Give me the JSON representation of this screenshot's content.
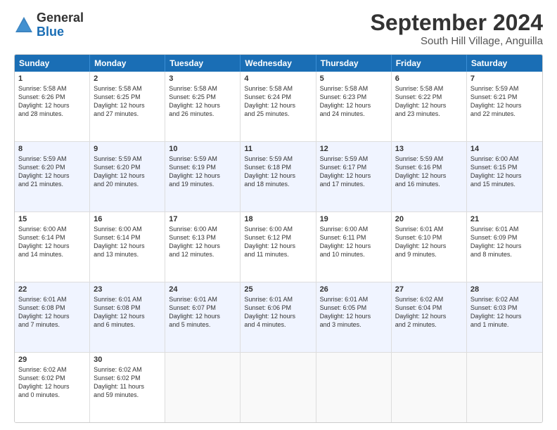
{
  "logo": {
    "general": "General",
    "blue": "Blue"
  },
  "title": "September 2024",
  "subtitle": "South Hill Village, Anguilla",
  "days": [
    "Sunday",
    "Monday",
    "Tuesday",
    "Wednesday",
    "Thursday",
    "Friday",
    "Saturday"
  ],
  "rows": [
    [
      {
        "day": "1",
        "lines": [
          "Sunrise: 5:58 AM",
          "Sunset: 6:26 PM",
          "Daylight: 12 hours",
          "and 28 minutes."
        ]
      },
      {
        "day": "2",
        "lines": [
          "Sunrise: 5:58 AM",
          "Sunset: 6:25 PM",
          "Daylight: 12 hours",
          "and 27 minutes."
        ]
      },
      {
        "day": "3",
        "lines": [
          "Sunrise: 5:58 AM",
          "Sunset: 6:25 PM",
          "Daylight: 12 hours",
          "and 26 minutes."
        ]
      },
      {
        "day": "4",
        "lines": [
          "Sunrise: 5:58 AM",
          "Sunset: 6:24 PM",
          "Daylight: 12 hours",
          "and 25 minutes."
        ]
      },
      {
        "day": "5",
        "lines": [
          "Sunrise: 5:58 AM",
          "Sunset: 6:23 PM",
          "Daylight: 12 hours",
          "and 24 minutes."
        ]
      },
      {
        "day": "6",
        "lines": [
          "Sunrise: 5:58 AM",
          "Sunset: 6:22 PM",
          "Daylight: 12 hours",
          "and 23 minutes."
        ]
      },
      {
        "day": "7",
        "lines": [
          "Sunrise: 5:59 AM",
          "Sunset: 6:21 PM",
          "Daylight: 12 hours",
          "and 22 minutes."
        ]
      }
    ],
    [
      {
        "day": "8",
        "lines": [
          "Sunrise: 5:59 AM",
          "Sunset: 6:20 PM",
          "Daylight: 12 hours",
          "and 21 minutes."
        ]
      },
      {
        "day": "9",
        "lines": [
          "Sunrise: 5:59 AM",
          "Sunset: 6:20 PM",
          "Daylight: 12 hours",
          "and 20 minutes."
        ]
      },
      {
        "day": "10",
        "lines": [
          "Sunrise: 5:59 AM",
          "Sunset: 6:19 PM",
          "Daylight: 12 hours",
          "and 19 minutes."
        ]
      },
      {
        "day": "11",
        "lines": [
          "Sunrise: 5:59 AM",
          "Sunset: 6:18 PM",
          "Daylight: 12 hours",
          "and 18 minutes."
        ]
      },
      {
        "day": "12",
        "lines": [
          "Sunrise: 5:59 AM",
          "Sunset: 6:17 PM",
          "Daylight: 12 hours",
          "and 17 minutes."
        ]
      },
      {
        "day": "13",
        "lines": [
          "Sunrise: 5:59 AM",
          "Sunset: 6:16 PM",
          "Daylight: 12 hours",
          "and 16 minutes."
        ]
      },
      {
        "day": "14",
        "lines": [
          "Sunrise: 6:00 AM",
          "Sunset: 6:15 PM",
          "Daylight: 12 hours",
          "and 15 minutes."
        ]
      }
    ],
    [
      {
        "day": "15",
        "lines": [
          "Sunrise: 6:00 AM",
          "Sunset: 6:14 PM",
          "Daylight: 12 hours",
          "and 14 minutes."
        ]
      },
      {
        "day": "16",
        "lines": [
          "Sunrise: 6:00 AM",
          "Sunset: 6:14 PM",
          "Daylight: 12 hours",
          "and 13 minutes."
        ]
      },
      {
        "day": "17",
        "lines": [
          "Sunrise: 6:00 AM",
          "Sunset: 6:13 PM",
          "Daylight: 12 hours",
          "and 12 minutes."
        ]
      },
      {
        "day": "18",
        "lines": [
          "Sunrise: 6:00 AM",
          "Sunset: 6:12 PM",
          "Daylight: 12 hours",
          "and 11 minutes."
        ]
      },
      {
        "day": "19",
        "lines": [
          "Sunrise: 6:00 AM",
          "Sunset: 6:11 PM",
          "Daylight: 12 hours",
          "and 10 minutes."
        ]
      },
      {
        "day": "20",
        "lines": [
          "Sunrise: 6:01 AM",
          "Sunset: 6:10 PM",
          "Daylight: 12 hours",
          "and 9 minutes."
        ]
      },
      {
        "day": "21",
        "lines": [
          "Sunrise: 6:01 AM",
          "Sunset: 6:09 PM",
          "Daylight: 12 hours",
          "and 8 minutes."
        ]
      }
    ],
    [
      {
        "day": "22",
        "lines": [
          "Sunrise: 6:01 AM",
          "Sunset: 6:08 PM",
          "Daylight: 12 hours",
          "and 7 minutes."
        ]
      },
      {
        "day": "23",
        "lines": [
          "Sunrise: 6:01 AM",
          "Sunset: 6:08 PM",
          "Daylight: 12 hours",
          "and 6 minutes."
        ]
      },
      {
        "day": "24",
        "lines": [
          "Sunrise: 6:01 AM",
          "Sunset: 6:07 PM",
          "Daylight: 12 hours",
          "and 5 minutes."
        ]
      },
      {
        "day": "25",
        "lines": [
          "Sunrise: 6:01 AM",
          "Sunset: 6:06 PM",
          "Daylight: 12 hours",
          "and 4 minutes."
        ]
      },
      {
        "day": "26",
        "lines": [
          "Sunrise: 6:01 AM",
          "Sunset: 6:05 PM",
          "Daylight: 12 hours",
          "and 3 minutes."
        ]
      },
      {
        "day": "27",
        "lines": [
          "Sunrise: 6:02 AM",
          "Sunset: 6:04 PM",
          "Daylight: 12 hours",
          "and 2 minutes."
        ]
      },
      {
        "day": "28",
        "lines": [
          "Sunrise: 6:02 AM",
          "Sunset: 6:03 PM",
          "Daylight: 12 hours",
          "and 1 minute."
        ]
      }
    ],
    [
      {
        "day": "29",
        "lines": [
          "Sunrise: 6:02 AM",
          "Sunset: 6:02 PM",
          "Daylight: 12 hours",
          "and 0 minutes."
        ]
      },
      {
        "day": "30",
        "lines": [
          "Sunrise: 6:02 AM",
          "Sunset: 6:02 PM",
          "Daylight: 11 hours",
          "and 59 minutes."
        ]
      },
      {
        "day": "",
        "lines": []
      },
      {
        "day": "",
        "lines": []
      },
      {
        "day": "",
        "lines": []
      },
      {
        "day": "",
        "lines": []
      },
      {
        "day": "",
        "lines": []
      }
    ]
  ]
}
